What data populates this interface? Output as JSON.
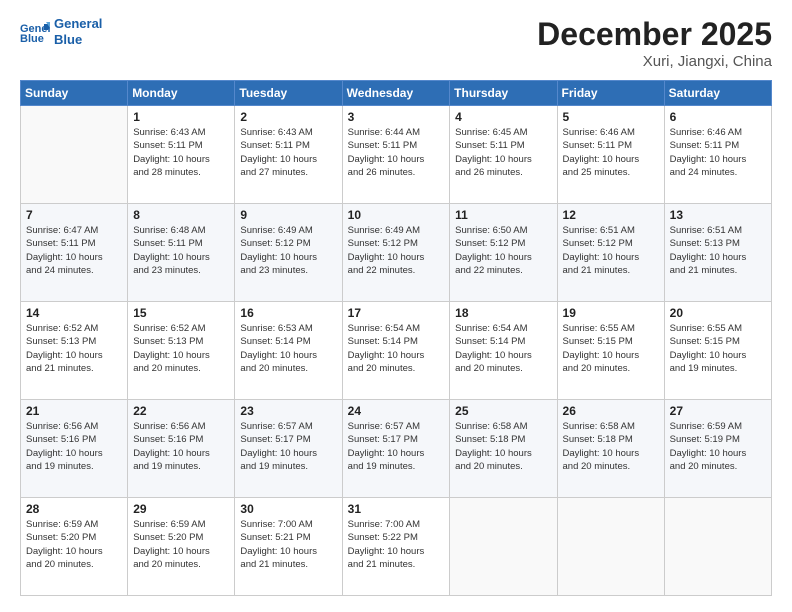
{
  "logo": {
    "line1": "General",
    "line2": "Blue"
  },
  "header": {
    "month": "December 2025",
    "location": "Xuri, Jiangxi, China"
  },
  "weekdays": [
    "Sunday",
    "Monday",
    "Tuesday",
    "Wednesday",
    "Thursday",
    "Friday",
    "Saturday"
  ],
  "weeks": [
    [
      {
        "day": "",
        "info": ""
      },
      {
        "day": "1",
        "info": "Sunrise: 6:43 AM\nSunset: 5:11 PM\nDaylight: 10 hours\nand 28 minutes."
      },
      {
        "day": "2",
        "info": "Sunrise: 6:43 AM\nSunset: 5:11 PM\nDaylight: 10 hours\nand 27 minutes."
      },
      {
        "day": "3",
        "info": "Sunrise: 6:44 AM\nSunset: 5:11 PM\nDaylight: 10 hours\nand 26 minutes."
      },
      {
        "day": "4",
        "info": "Sunrise: 6:45 AM\nSunset: 5:11 PM\nDaylight: 10 hours\nand 26 minutes."
      },
      {
        "day": "5",
        "info": "Sunrise: 6:46 AM\nSunset: 5:11 PM\nDaylight: 10 hours\nand 25 minutes."
      },
      {
        "day": "6",
        "info": "Sunrise: 6:46 AM\nSunset: 5:11 PM\nDaylight: 10 hours\nand 24 minutes."
      }
    ],
    [
      {
        "day": "7",
        "info": "Sunrise: 6:47 AM\nSunset: 5:11 PM\nDaylight: 10 hours\nand 24 minutes."
      },
      {
        "day": "8",
        "info": "Sunrise: 6:48 AM\nSunset: 5:11 PM\nDaylight: 10 hours\nand 23 minutes."
      },
      {
        "day": "9",
        "info": "Sunrise: 6:49 AM\nSunset: 5:12 PM\nDaylight: 10 hours\nand 23 minutes."
      },
      {
        "day": "10",
        "info": "Sunrise: 6:49 AM\nSunset: 5:12 PM\nDaylight: 10 hours\nand 22 minutes."
      },
      {
        "day": "11",
        "info": "Sunrise: 6:50 AM\nSunset: 5:12 PM\nDaylight: 10 hours\nand 22 minutes."
      },
      {
        "day": "12",
        "info": "Sunrise: 6:51 AM\nSunset: 5:12 PM\nDaylight: 10 hours\nand 21 minutes."
      },
      {
        "day": "13",
        "info": "Sunrise: 6:51 AM\nSunset: 5:13 PM\nDaylight: 10 hours\nand 21 minutes."
      }
    ],
    [
      {
        "day": "14",
        "info": "Sunrise: 6:52 AM\nSunset: 5:13 PM\nDaylight: 10 hours\nand 21 minutes."
      },
      {
        "day": "15",
        "info": "Sunrise: 6:52 AM\nSunset: 5:13 PM\nDaylight: 10 hours\nand 20 minutes."
      },
      {
        "day": "16",
        "info": "Sunrise: 6:53 AM\nSunset: 5:14 PM\nDaylight: 10 hours\nand 20 minutes."
      },
      {
        "day": "17",
        "info": "Sunrise: 6:54 AM\nSunset: 5:14 PM\nDaylight: 10 hours\nand 20 minutes."
      },
      {
        "day": "18",
        "info": "Sunrise: 6:54 AM\nSunset: 5:14 PM\nDaylight: 10 hours\nand 20 minutes."
      },
      {
        "day": "19",
        "info": "Sunrise: 6:55 AM\nSunset: 5:15 PM\nDaylight: 10 hours\nand 20 minutes."
      },
      {
        "day": "20",
        "info": "Sunrise: 6:55 AM\nSunset: 5:15 PM\nDaylight: 10 hours\nand 19 minutes."
      }
    ],
    [
      {
        "day": "21",
        "info": "Sunrise: 6:56 AM\nSunset: 5:16 PM\nDaylight: 10 hours\nand 19 minutes."
      },
      {
        "day": "22",
        "info": "Sunrise: 6:56 AM\nSunset: 5:16 PM\nDaylight: 10 hours\nand 19 minutes."
      },
      {
        "day": "23",
        "info": "Sunrise: 6:57 AM\nSunset: 5:17 PM\nDaylight: 10 hours\nand 19 minutes."
      },
      {
        "day": "24",
        "info": "Sunrise: 6:57 AM\nSunset: 5:17 PM\nDaylight: 10 hours\nand 19 minutes."
      },
      {
        "day": "25",
        "info": "Sunrise: 6:58 AM\nSunset: 5:18 PM\nDaylight: 10 hours\nand 20 minutes."
      },
      {
        "day": "26",
        "info": "Sunrise: 6:58 AM\nSunset: 5:18 PM\nDaylight: 10 hours\nand 20 minutes."
      },
      {
        "day": "27",
        "info": "Sunrise: 6:59 AM\nSunset: 5:19 PM\nDaylight: 10 hours\nand 20 minutes."
      }
    ],
    [
      {
        "day": "28",
        "info": "Sunrise: 6:59 AM\nSunset: 5:20 PM\nDaylight: 10 hours\nand 20 minutes."
      },
      {
        "day": "29",
        "info": "Sunrise: 6:59 AM\nSunset: 5:20 PM\nDaylight: 10 hours\nand 20 minutes."
      },
      {
        "day": "30",
        "info": "Sunrise: 7:00 AM\nSunset: 5:21 PM\nDaylight: 10 hours\nand 21 minutes."
      },
      {
        "day": "31",
        "info": "Sunrise: 7:00 AM\nSunset: 5:22 PM\nDaylight: 10 hours\nand 21 minutes."
      },
      {
        "day": "",
        "info": ""
      },
      {
        "day": "",
        "info": ""
      },
      {
        "day": "",
        "info": ""
      }
    ]
  ]
}
